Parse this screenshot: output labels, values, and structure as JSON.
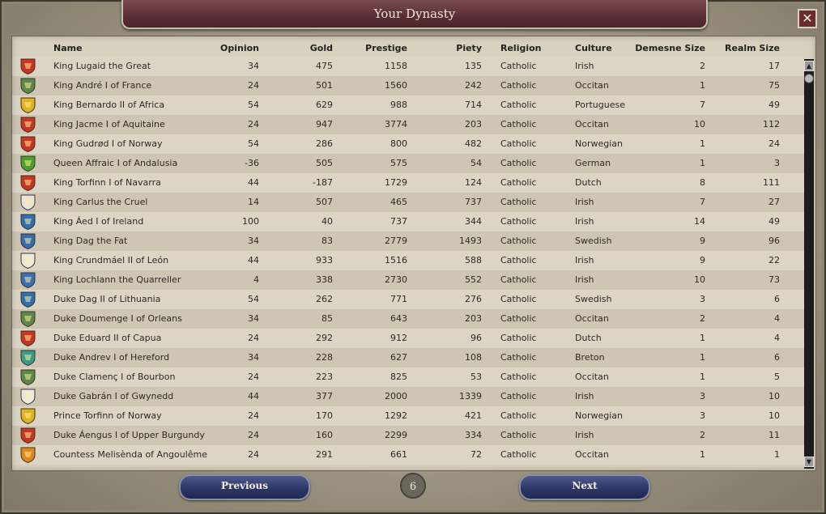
{
  "window": {
    "title": "Your Dynasty",
    "close_label": "✕"
  },
  "table": {
    "columns": {
      "name": "Name",
      "opinion": "Opinion",
      "gold": "Gold",
      "prestige": "Prestige",
      "piety": "Piety",
      "religion": "Religion",
      "culture": "Culture",
      "demesne": "Demesne Size",
      "realm": "Realm Size"
    },
    "rows": [
      {
        "name": "King Lugaid the Great",
        "opinion": "34",
        "gold": "475",
        "prestige": "1158",
        "piety": "135",
        "religion": "Catholic",
        "culture": "Irish",
        "demesne": "2",
        "realm": "17",
        "coa": "#c8341f"
      },
      {
        "name": "King André I of France",
        "opinion": "24",
        "gold": "501",
        "prestige": "1560",
        "piety": "242",
        "religion": "Catholic",
        "culture": "Occitan",
        "demesne": "1",
        "realm": "75",
        "coa": "#5a8a4a"
      },
      {
        "name": "King Bernardo II of Africa",
        "opinion": "54",
        "gold": "629",
        "prestige": "988",
        "piety": "714",
        "religion": "Catholic",
        "culture": "Portuguese",
        "demesne": "7",
        "realm": "49",
        "coa": "#e0b21c"
      },
      {
        "name": "King Jacme I of Aquitaine",
        "opinion": "24",
        "gold": "947",
        "prestige": "3774",
        "piety": "203",
        "religion": "Catholic",
        "culture": "Occitan",
        "demesne": "10",
        "realm": "112",
        "coa": "#c8341f"
      },
      {
        "name": "King Gudrød I of Norway",
        "opinion": "54",
        "gold": "286",
        "prestige": "800",
        "piety": "482",
        "religion": "Catholic",
        "culture": "Norwegian",
        "demesne": "1",
        "realm": "24",
        "coa": "#c8341f"
      },
      {
        "name": "Queen Affraic I of Andalusia",
        "opinion": "-36",
        "gold": "505",
        "prestige": "575",
        "piety": "54",
        "religion": "Catholic",
        "culture": "German",
        "demesne": "1",
        "realm": "3",
        "coa": "#4aa02c"
      },
      {
        "name": "King Torfinn I of Navarra",
        "opinion": "44",
        "gold": "-187",
        "prestige": "1729",
        "piety": "124",
        "religion": "Catholic",
        "culture": "Dutch",
        "demesne": "8",
        "realm": "111",
        "coa": "#c8341f"
      },
      {
        "name": "King Carlus the Cruel",
        "opinion": "14",
        "gold": "507",
        "prestige": "465",
        "piety": "737",
        "religion": "Catholic",
        "culture": "Irish",
        "demesne": "7",
        "realm": "27",
        "coa": "#e8e4dc"
      },
      {
        "name": "King Áed I of Ireland",
        "opinion": "100",
        "gold": "40",
        "prestige": "737",
        "piety": "344",
        "religion": "Catholic",
        "culture": "Irish",
        "demesne": "14",
        "realm": "49",
        "coa": "#2f6fb0"
      },
      {
        "name": "King Dag the Fat",
        "opinion": "34",
        "gold": "83",
        "prestige": "2779",
        "piety": "1493",
        "religion": "Catholic",
        "culture": "Swedish",
        "demesne": "9",
        "realm": "96",
        "coa": "#2f6fb0"
      },
      {
        "name": "King Crundmáel II of León",
        "opinion": "44",
        "gold": "933",
        "prestige": "1516",
        "piety": "588",
        "religion": "Catholic",
        "culture": "Irish",
        "demesne": "9",
        "realm": "22",
        "coa": "#ece8e0"
      },
      {
        "name": "King Lochlann the Quarreller",
        "opinion": "4",
        "gold": "338",
        "prestige": "2730",
        "piety": "552",
        "religion": "Catholic",
        "culture": "Irish",
        "demesne": "10",
        "realm": "73",
        "coa": "#3a6fb8"
      },
      {
        "name": "Duke Dag II of Lithuania",
        "opinion": "54",
        "gold": "262",
        "prestige": "771",
        "piety": "276",
        "religion": "Catholic",
        "culture": "Swedish",
        "demesne": "3",
        "realm": "6",
        "coa": "#2f6fb0"
      },
      {
        "name": "Duke Doumenge I of Orleans",
        "opinion": "34",
        "gold": "85",
        "prestige": "643",
        "piety": "203",
        "religion": "Catholic",
        "culture": "Occitan",
        "demesne": "2",
        "realm": "4",
        "coa": "#5a8a4a"
      },
      {
        "name": "Duke Eduard II of Capua",
        "opinion": "24",
        "gold": "292",
        "prestige": "912",
        "piety": "96",
        "religion": "Catholic",
        "culture": "Dutch",
        "demesne": "1",
        "realm": "4",
        "coa": "#c8341f"
      },
      {
        "name": "Duke Andrev I of Hereford",
        "opinion": "34",
        "gold": "228",
        "prestige": "627",
        "piety": "108",
        "religion": "Catholic",
        "culture": "Breton",
        "demesne": "1",
        "realm": "6",
        "coa": "#3a9a8a"
      },
      {
        "name": "Duke Clamenç I of Bourbon",
        "opinion": "24",
        "gold": "223",
        "prestige": "825",
        "piety": "53",
        "religion": "Catholic",
        "culture": "Occitan",
        "demesne": "1",
        "realm": "5",
        "coa": "#5a8a4a"
      },
      {
        "name": "Duke Gabrán I of Gwynedd",
        "opinion": "44",
        "gold": "377",
        "prestige": "2000",
        "piety": "1339",
        "religion": "Catholic",
        "culture": "Irish",
        "demesne": "3",
        "realm": "10",
        "coa": "#ece8e0"
      },
      {
        "name": "Prince Torfinn of Norway",
        "opinion": "24",
        "gold": "170",
        "prestige": "1292",
        "piety": "421",
        "religion": "Catholic",
        "culture": "Norwegian",
        "demesne": "3",
        "realm": "10",
        "coa": "#e0b21c"
      },
      {
        "name": "Duke Áengus I of Upper Burgundy",
        "opinion": "24",
        "gold": "160",
        "prestige": "2299",
        "piety": "334",
        "religion": "Catholic",
        "culture": "Irish",
        "demesne": "2",
        "realm": "11",
        "coa": "#c8341f"
      },
      {
        "name": "Countess Melisènda of Angoulême",
        "opinion": "24",
        "gold": "291",
        "prestige": "661",
        "piety": "72",
        "religion": "Catholic",
        "culture": "Occitan",
        "demesne": "1",
        "realm": "1",
        "coa": "#e0861c"
      }
    ]
  },
  "pagination": {
    "previous_label": "Previous",
    "next_label": "Next",
    "page": "6"
  },
  "scrollbar": {
    "up_icon": "▲",
    "down_icon": "▼"
  }
}
